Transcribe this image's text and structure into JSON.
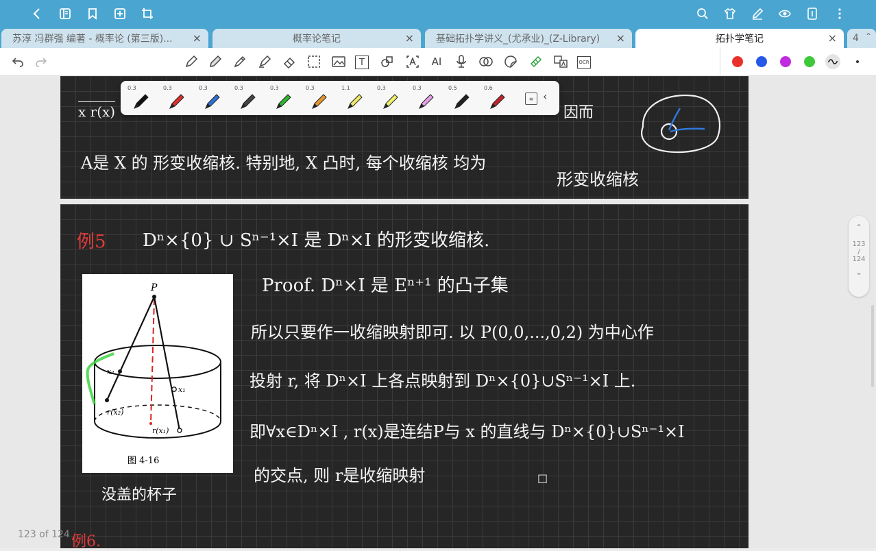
{
  "tabs": [
    {
      "title": "苏淳 冯群强 编著 - 概率论 (第三版)..."
    },
    {
      "title": "概率论笔记"
    },
    {
      "title": "基础拓扑学讲义_(尤承业)_(Z-Library)"
    },
    {
      "title": "拓扑学笔记",
      "active": true
    },
    {
      "title": "4"
    }
  ],
  "tab_close": "×",
  "pen_sizes": [
    "0.3",
    "0.3",
    "0.3",
    "0.3",
    "0.3",
    "0.3",
    "1.1",
    "0.3",
    "0.3",
    "0.5",
    "0.6"
  ],
  "pen_colors": [
    "#111111",
    "#d9312e",
    "#2f6fd6",
    "#444444",
    "#2fb52f",
    "#e7962c",
    "#f0e66a",
    "#f0f06a",
    "#e6a0e6",
    "#222222",
    "#c0242a"
  ],
  "palette_colors": [
    "#e8312a",
    "#2558e8",
    "#c02ae0",
    "#3ec83a"
  ],
  "icons": {
    "back": "back-icon",
    "library": "library-icon",
    "bookmark": "bookmark-icon",
    "add": "add-page-icon",
    "crop": "crop-icon",
    "search": "search-icon",
    "theme": "shirt-icon",
    "pen": "pen-icon",
    "view": "eye-icon",
    "pad": "tablet-icon",
    "more": "more-icon"
  },
  "toolbar": {
    "text_tool": "T",
    "ai_tool": "AI",
    "ocr_tool": "OCR"
  },
  "pager": {
    "current": "123",
    "sep": "/",
    "total": "124"
  },
  "page_count": "123 of 124",
  "notes": {
    "top_line1": "x r(x)",
    "top_line1b": "因而",
    "top_line2": "A是 X 的 形变收缩核. 特别地, X 凸时, 每个收缩核 均为",
    "top_line2b": "形变收缩核",
    "ex5_label": "例5",
    "ex5_statement": "Dⁿ×{0} ∪ Sⁿ⁻¹×I  是 Dⁿ×I  的形变收缩核.",
    "proof_line1": "Proof.  Dⁿ×I 是 Eⁿ⁺¹ 的凸子集",
    "proof_line2": "所以只要作一收缩映射即可.   以 P(0,0,...,0,2) 为中心作",
    "proof_line3": "投射 r, 将 Dⁿ×I 上各点映射到 Dⁿ×{0}∪Sⁿ⁻¹×I 上.",
    "proof_line4": "即∀x∈Dⁿ×I ,  r(x)是连结P与 x 的直线与 Dⁿ×{0}∪Sⁿ⁻¹×I",
    "proof_line5": "的交点,   则 r是收缩映射",
    "qed": "□",
    "caption_hand": "没盖的杯子",
    "ex6_label": "例6."
  },
  "figure": {
    "label_P": "P",
    "label_x2": "x₂",
    "label_x1": "x₁",
    "label_rx2": "r(x₂)",
    "label_rx1": "r(x₁)",
    "caption": "图  4-16"
  }
}
